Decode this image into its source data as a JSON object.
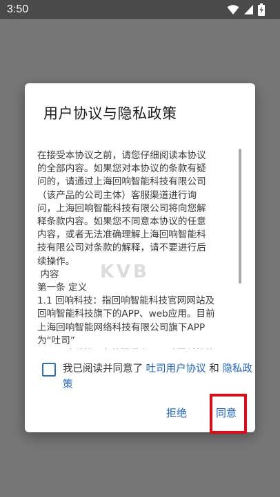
{
  "status_bar": {
    "time": "3:50",
    "icons": [
      "wifi-icon",
      "signal-icon",
      "battery-charging-icon"
    ]
  },
  "dialog": {
    "title": "用户协议与隐私政策",
    "content_lines": [
      "在接受本协议之前，请您仔细阅读本协议",
      "的全部内容。如果您对本协议的条款有疑",
      "问的，请通过上海回响智能科技有限公司",
      "（该产品的公司主体）客服渠道进行询",
      "问，上海回响智能科技有限公司将向您解",
      "释条款内容。如果您不同意本协议的任意",
      "内容，或者无法准确理解上海回响智能科",
      "技有限公司对条款的解释，请不要进行后",
      "续操作。",
      " 内容",
      "第一条 定义",
      "1.1 回响科技：指回响智能科技官网网站及",
      "回响智能科技旗下的APP、web应用。目前",
      "上海回响智能网络科技有限公司旗下APP",
      "为“吐司”",
      "1.2 回响科技服务的提供者：即啤翼科技的"
    ],
    "consent": {
      "prefix": "我已阅读并同意了 ",
      "user_agreement_link": "吐司用户协议",
      "conjunction": " 和 ",
      "privacy_link": "隐私政策"
    },
    "buttons": {
      "reject": "拒绝",
      "agree": "同意"
    }
  },
  "colors": {
    "accent": "#1e63c8",
    "highlight": "#e10b17"
  }
}
